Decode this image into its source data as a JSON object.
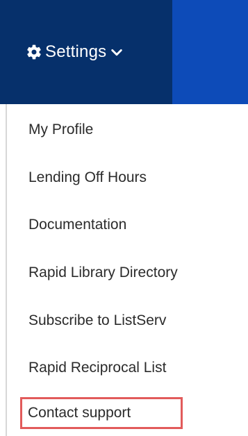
{
  "header": {
    "settings_label": "Settings"
  },
  "menu": {
    "items": [
      {
        "label": "My Profile"
      },
      {
        "label": "Lending Off Hours"
      },
      {
        "label": "Documentation"
      },
      {
        "label": "Rapid Library Directory"
      },
      {
        "label": "Subscribe to ListServ"
      },
      {
        "label": "Rapid Reciprocal List"
      },
      {
        "label": "Contact support"
      }
    ]
  },
  "colors": {
    "nav_dark": "#06306b",
    "nav_bright": "#0d4bb8",
    "text": "#2b2b2b",
    "highlight": "#e25b5b"
  },
  "icons": {
    "settings": "gear-icon",
    "dropdown": "chevron-down-icon"
  }
}
